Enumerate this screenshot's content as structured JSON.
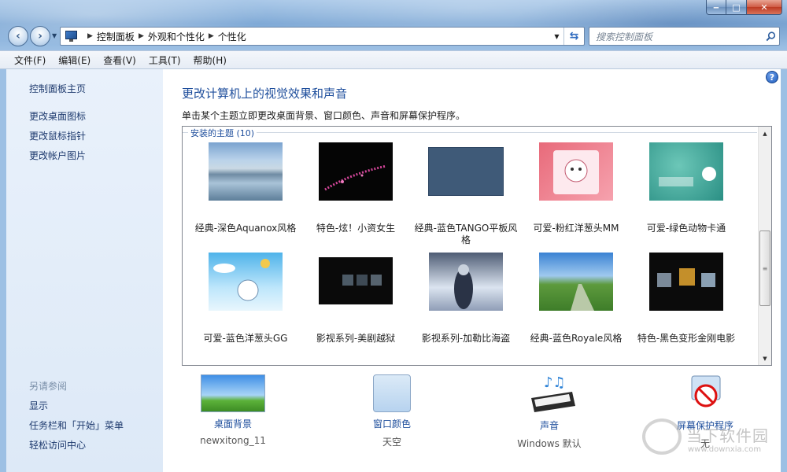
{
  "window": {
    "caption_min": "‒",
    "caption_max": "□",
    "caption_close": "✕"
  },
  "nav": {
    "back": "‹",
    "forward": "›",
    "dropdown": "▼",
    "breadcrumbs": [
      "控制面板",
      "外观和个性化",
      "个性化"
    ],
    "sep": "▶",
    "addr_dropdown": "▼",
    "refresh": "⇆",
    "search_placeholder": "搜索控制面板"
  },
  "menu": [
    "文件(F)",
    "编辑(E)",
    "查看(V)",
    "工具(T)",
    "帮助(H)"
  ],
  "sidebar": {
    "home": "控制面板主页",
    "links": [
      "更改桌面图标",
      "更改鼠标指针",
      "更改帐户图片"
    ],
    "see_also_title": "另请参阅",
    "see_also": [
      "显示",
      "任务栏和「开始」菜单",
      "轻松访问中心"
    ]
  },
  "main": {
    "title": "更改计算机上的视觉效果和声音",
    "description": "单击某个主题立即更改桌面背景、窗口颜色、声音和屏幕保护程序。",
    "group_label": "安装的主题 (10)",
    "help": "?"
  },
  "themes": [
    {
      "name": "经典-深色Aquanox风格",
      "style": "t-aqua"
    },
    {
      "name": "特色-炫！小资女生",
      "style": "t-sakura"
    },
    {
      "name": "经典-蓝色TANGO平板风格",
      "style": "t-tango"
    },
    {
      "name": "可爱-粉红洋葱头MM",
      "style": "t-pink"
    },
    {
      "name": "可爱-绿色动物卡通",
      "style": "t-green"
    },
    {
      "name": "可爱-蓝色洋葱头GG",
      "style": "t-blue"
    },
    {
      "name": "影视系列-美剧越狱",
      "style": "t-prison"
    },
    {
      "name": "影视系列-加勒比海盗",
      "style": "t-pirate"
    },
    {
      "name": "经典-蓝色Royale风格",
      "style": "t-royale"
    },
    {
      "name": "特色-黑色变形金刚电影",
      "style": "t-tf"
    }
  ],
  "bottom": [
    {
      "label": "桌面背景",
      "sub": "newxitong_11"
    },
    {
      "label": "窗口颜色",
      "sub": "天空"
    },
    {
      "label": "声音",
      "sub": "Windows 默认"
    },
    {
      "label": "屏幕保护程序",
      "sub": "无"
    }
  ],
  "scrollbar": {
    "up": "▲",
    "down": "▼",
    "grip": "≡"
  },
  "watermark": {
    "text": "当下软件园",
    "url": "www.downxia.com"
  }
}
